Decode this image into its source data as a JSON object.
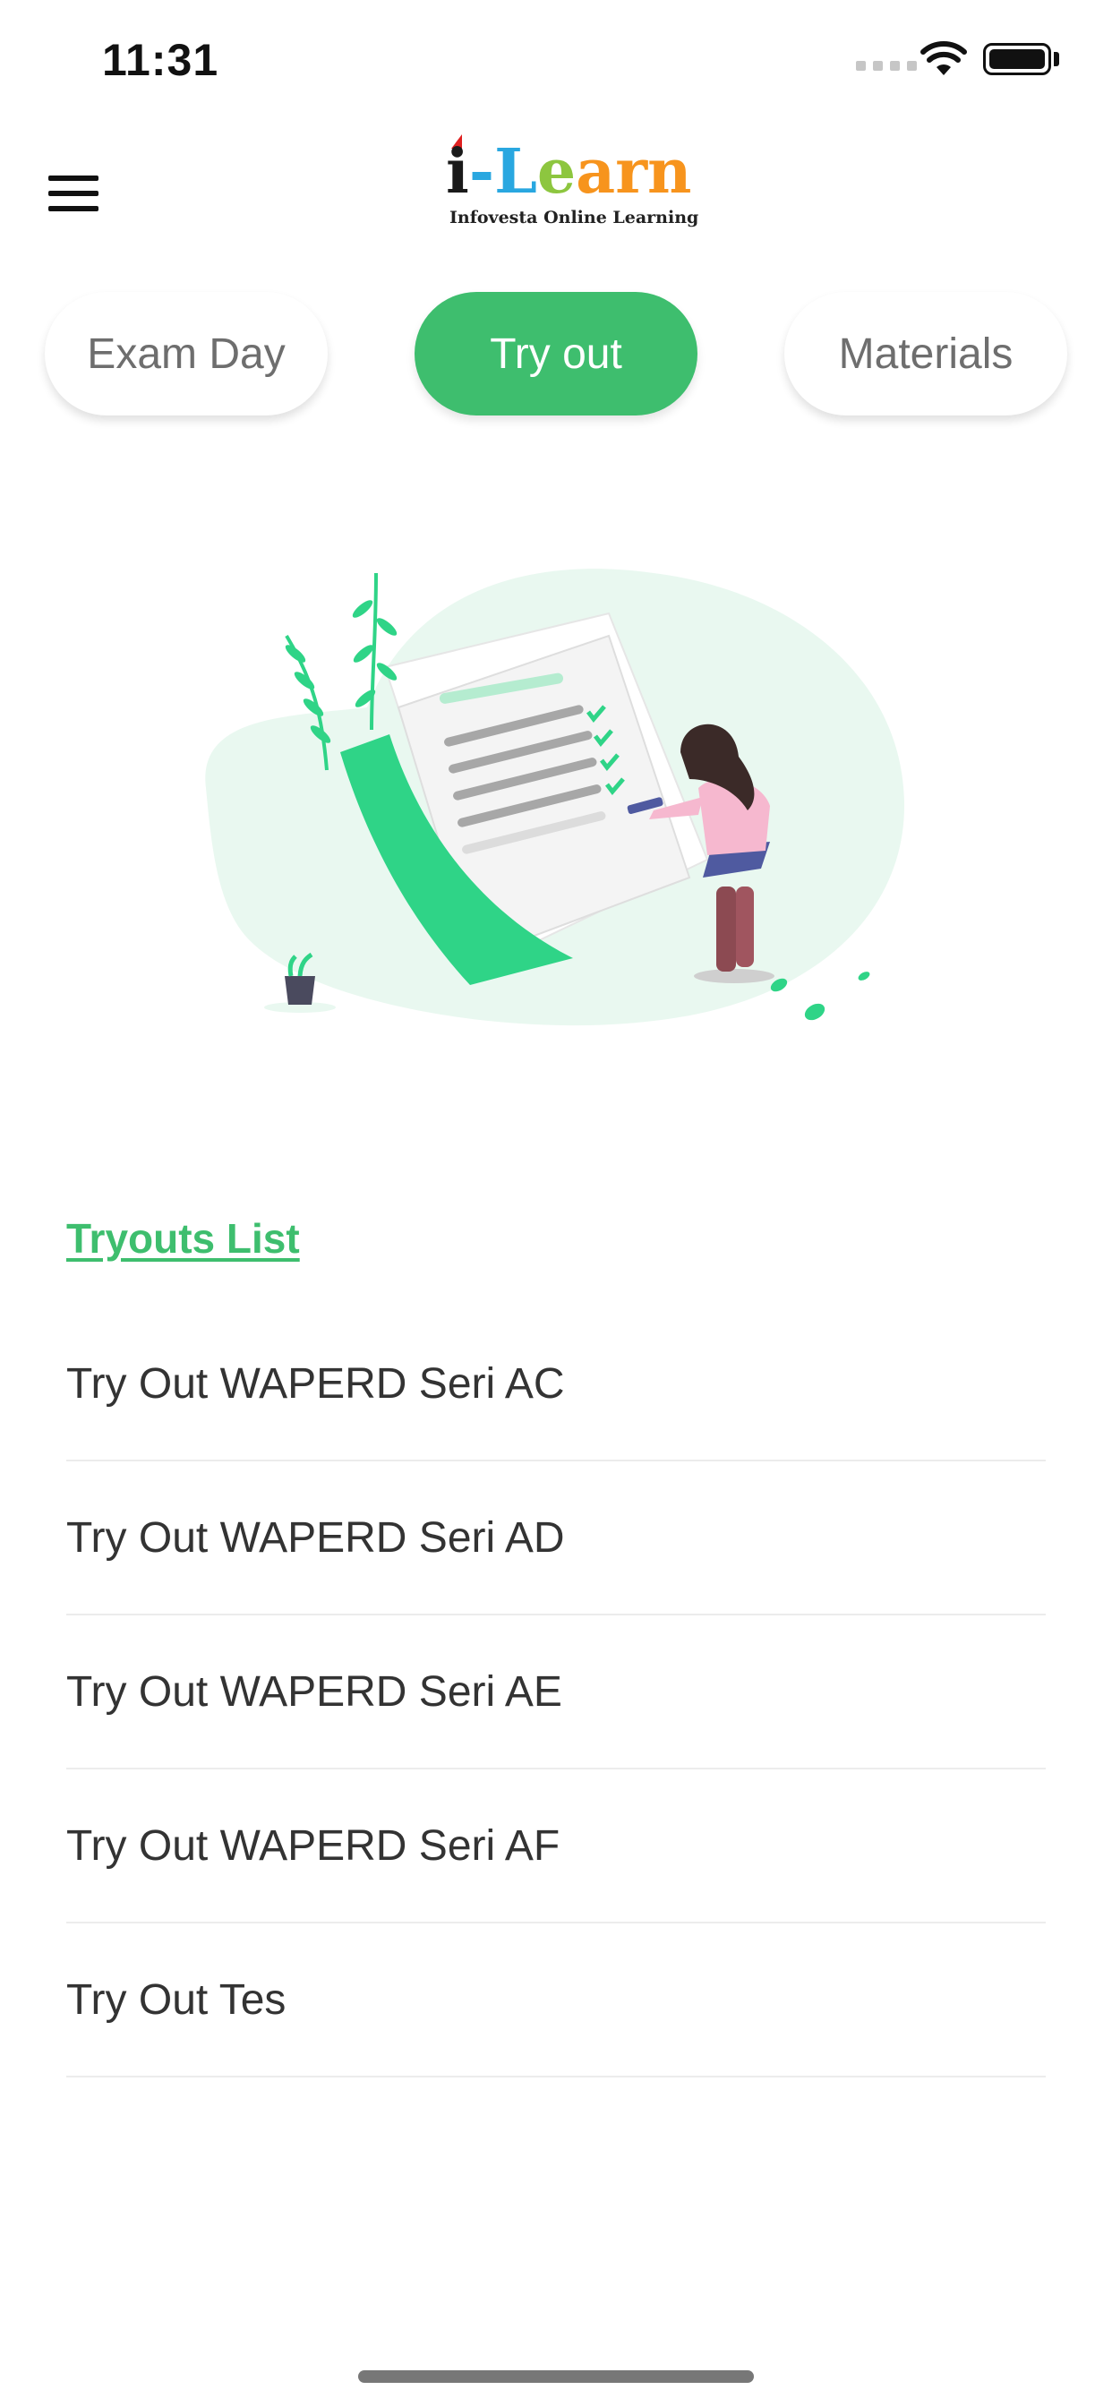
{
  "status_bar": {
    "time": "11:31"
  },
  "header": {
    "logo_brand_parts": [
      "i",
      "-",
      "L",
      "e",
      "a",
      "r",
      "n"
    ],
    "logo_subtitle": "Infovesta Online Learning"
  },
  "tabs": [
    {
      "label": "Exam Day",
      "active": false
    },
    {
      "label": "Try out",
      "active": true
    },
    {
      "label": "Materials",
      "active": false
    }
  ],
  "colors": {
    "accent": "#3ebe6e",
    "illustration_green": "#2fd487",
    "light_green": "#e9f8f0"
  },
  "tryouts": {
    "title": "Tryouts List",
    "items": [
      "Try Out WAPERD Seri AC",
      "Try Out WAPERD Seri AD",
      "Try Out WAPERD Seri AE",
      "Try Out WAPERD Seri AF",
      "Try Out Tes"
    ]
  }
}
